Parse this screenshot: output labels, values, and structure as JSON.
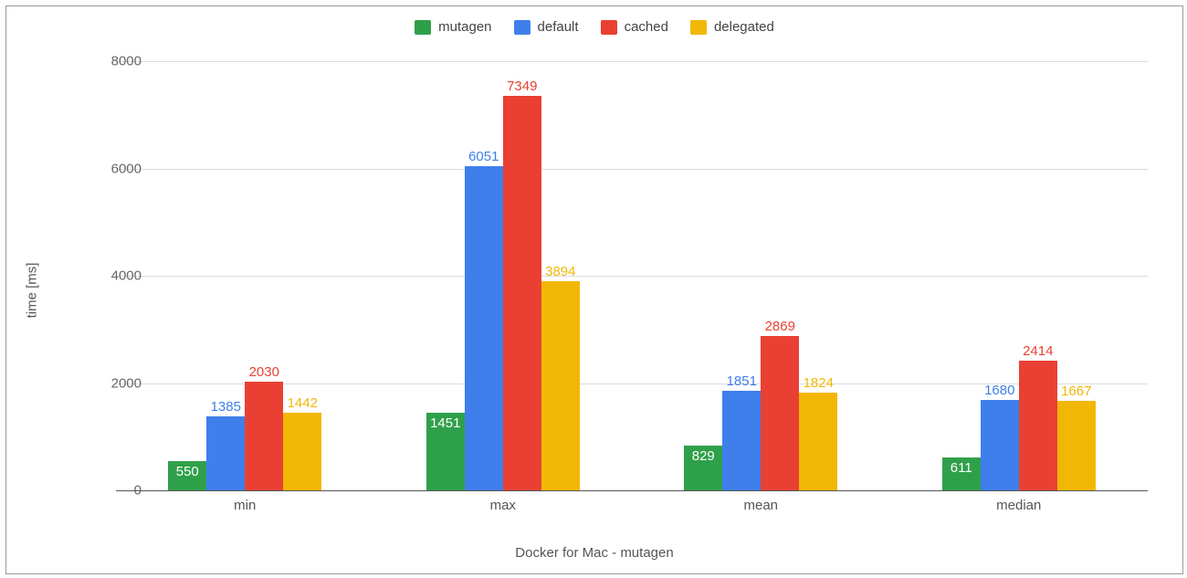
{
  "chart_data": {
    "type": "bar",
    "title": "",
    "xlabel": "Docker for Mac - mutagen",
    "ylabel": "time [ms]",
    "ylim": [
      0,
      8000
    ],
    "y_ticks": [
      0,
      2000,
      4000,
      6000,
      8000
    ],
    "categories": [
      "min",
      "max",
      "mean",
      "median"
    ],
    "series": [
      {
        "name": "mutagen",
        "color": "#2fa04a",
        "values": [
          550,
          1451,
          829,
          611
        ]
      },
      {
        "name": "default",
        "color": "#3f7fec",
        "values": [
          1385,
          6051,
          1851,
          1680
        ]
      },
      {
        "name": "cached",
        "color": "#e94033",
        "values": [
          2030,
          7349,
          2869,
          2414
        ]
      },
      {
        "name": "delegated",
        "color": "#f2b705",
        "values": [
          1442,
          3894,
          1824,
          1667
        ]
      }
    ],
    "label_text_colors": {
      "mutagen": "#ffffff",
      "default": "#3f7fec",
      "cached": "#e94033",
      "delegated": "#f2b705"
    },
    "label_bg_colors": {
      "mutagen": "#2fa04a",
      "default": "transparent",
      "cached": "transparent",
      "delegated": "transparent"
    }
  }
}
